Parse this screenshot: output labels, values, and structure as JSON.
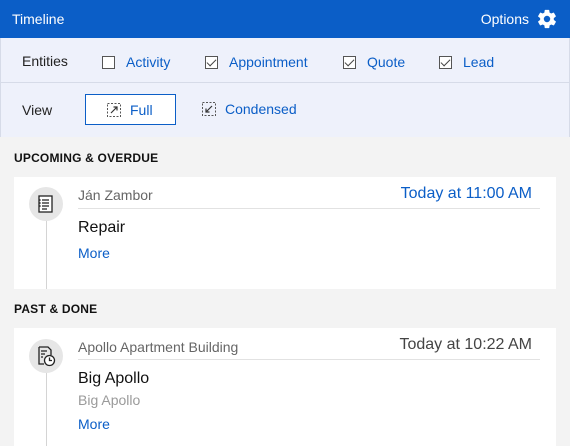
{
  "header": {
    "title": "Timeline",
    "options_label": "Options",
    "options_icon": "gear-icon",
    "color": "#0b5ec7"
  },
  "filters": {
    "entities_label": "Entities",
    "entities": [
      {
        "label": "Activity",
        "checked": false
      },
      {
        "label": "Appointment",
        "checked": true
      },
      {
        "label": "Quote",
        "checked": true
      },
      {
        "label": "Lead",
        "checked": true
      }
    ],
    "view_label": "View",
    "views": [
      {
        "label": "Full",
        "active": true,
        "icon": "expand-icon"
      },
      {
        "label": "Condensed",
        "active": false,
        "icon": "collapse-icon"
      }
    ]
  },
  "sections": [
    {
      "title": "UPCOMING & OVERDUE",
      "items": [
        {
          "icon": "note-list-icon",
          "owner": "Ján Zambor",
          "date": "Today at 11:00 AM",
          "date_color": "#0b5ec7",
          "subject": "Repair",
          "description": "",
          "more_label": "More"
        }
      ]
    },
    {
      "title": "PAST & DONE",
      "items": [
        {
          "icon": "document-clock-icon",
          "owner": "Apollo Apartment Building",
          "date": "Today at 10:22 AM",
          "date_color": "#444444",
          "subject": "Big Apollo",
          "description": "Big Apollo",
          "more_label": "More"
        }
      ]
    }
  ]
}
